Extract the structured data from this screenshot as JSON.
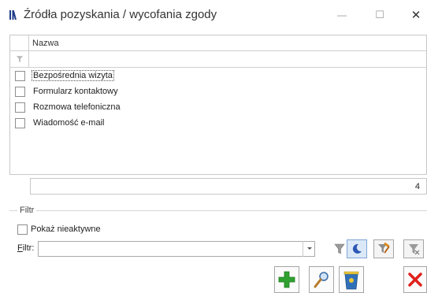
{
  "window": {
    "title": "Źródła pozyskania / wycofania zgody",
    "minimize_glyph": "—",
    "maximize_glyph": "☐",
    "close_glyph": "✕"
  },
  "grid": {
    "column_header": "Nazwa",
    "rows": [
      {
        "label": "Bezpośrednia wizyta",
        "checked": false,
        "selected": true
      },
      {
        "label": "Formularz kontaktowy",
        "checked": false,
        "selected": false
      },
      {
        "label": "Rozmowa telefoniczna",
        "checked": false,
        "selected": false
      },
      {
        "label": "Wiadomość e-mail",
        "checked": false,
        "selected": false
      }
    ],
    "footer_count": "4"
  },
  "filter_group": {
    "title": "Filtr",
    "show_inactive_label": "Pokaż nieaktywne",
    "show_inactive_checked": false,
    "filter_label_prefix": "F",
    "filter_label_rest": "iltr:",
    "filter_value": ""
  },
  "icons": {
    "app": "app-list-icon",
    "column_filter": "funnel-icon",
    "filter_apply": "funnel-icon",
    "filter_moon": "moon-icon",
    "filter_tool": "funnel-hammer-icon",
    "filter_clear": "funnel-clear-icon",
    "add": "plus-icon",
    "edit": "magnifier-icon",
    "delete": "trash-icon",
    "cancel": "close-x-icon"
  },
  "colors": {
    "add_green": "#2fa12f",
    "cancel_red": "#e0201b",
    "delete_blue": "#2f6fb8",
    "delete_yellow": "#e9c63a",
    "app_icon_blue": "#1f3d8a",
    "active_blue": "#dbe8f7"
  }
}
